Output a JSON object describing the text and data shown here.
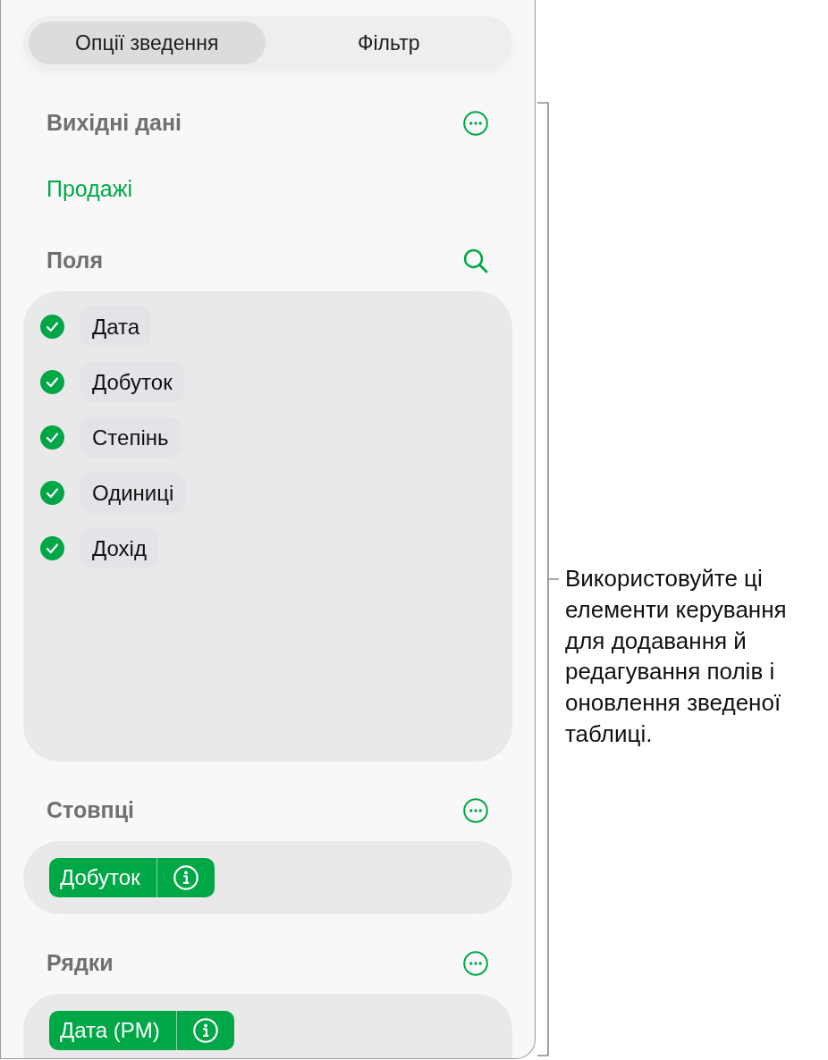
{
  "tabs": [
    {
      "label": "Опції зведення",
      "selected": true
    },
    {
      "label": "Фільтр",
      "selected": false
    }
  ],
  "sections": [
    {
      "kind": "source",
      "heading": "Вихідні дані",
      "value": "Продажі"
    },
    {
      "kind": "fields",
      "heading": "Поля",
      "fields": [
        {
          "label": "Дата",
          "checked": true
        },
        {
          "label": "Добуток",
          "checked": true
        },
        {
          "label": "Степінь",
          "checked": true
        },
        {
          "label": "Одиниці",
          "checked": true
        },
        {
          "label": "Дохід",
          "checked": true
        }
      ]
    },
    {
      "kind": "chips",
      "heading": "Стовпці",
      "chips": [
        {
          "label": "Добуток"
        }
      ]
    },
    {
      "kind": "chips",
      "heading": "Рядки",
      "chips": [
        {
          "label": "Дата (PM)"
        }
      ]
    }
  ],
  "callout": {
    "text": "Використовуйте ці елементи керування для додавання й редагування полів і оновлення зведеної таблиці."
  }
}
